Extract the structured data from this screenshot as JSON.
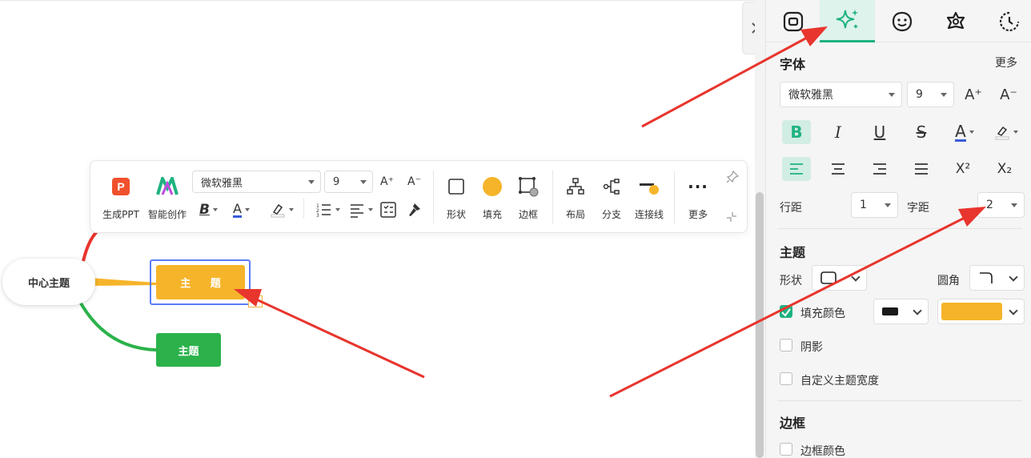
{
  "mindmap": {
    "center_topic": "中心主题",
    "topic_1": "主 题",
    "topic_2": "主题"
  },
  "toolbar": {
    "ppt_label": "生成PPT",
    "ai_label": "智能创作",
    "font_family": "微软雅黑",
    "font_size": "9",
    "font_increase": "A⁺",
    "font_decrease": "A⁻",
    "bold": "B",
    "font_color": "A",
    "shape_label": "形状",
    "fill_label": "填充",
    "border_label": "边框",
    "layout_label": "布局",
    "branch_label": "分支",
    "connector_label": "连接线",
    "more_label": "更多",
    "more_dots": "···"
  },
  "panel": {
    "font_section": "字体",
    "more_link": "更多",
    "font_family": "微软雅黑",
    "font_size": "9",
    "font_increase": "A⁺",
    "font_decrease": "A⁻",
    "bold": "B",
    "italic": "I",
    "underline": "U",
    "strikethrough": "S",
    "font_color": "A",
    "superscript": "X²",
    "subscript": "X₂",
    "line_spacing_label": "行距",
    "line_spacing_value": "1",
    "letter_spacing_label": "字距",
    "letter_spacing_value": "2",
    "topic_section": "主题",
    "shape_label": "形状",
    "corner_label": "圆角",
    "fill_color_label": "填充颜色",
    "shadow_label": "阴影",
    "custom_width_label": "自定义主题宽度",
    "border_section": "边框",
    "border_color_label": "边框颜色"
  },
  "colors": {
    "accent": "#1fb281",
    "topic_fill": "#f6b42a",
    "topic_green": "#2bb24b",
    "branch_red": "#e8352d",
    "selection": "#5b7cf5",
    "arrow": "#e8352d"
  }
}
